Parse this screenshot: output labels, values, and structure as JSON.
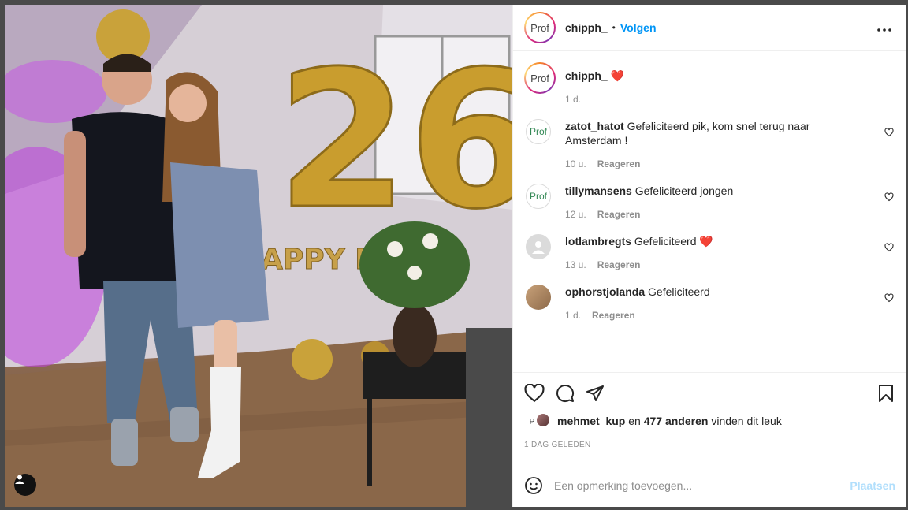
{
  "post": {
    "author": "chipph_",
    "follow_label": "Volgen",
    "separator": "•",
    "more_label": "•••",
    "avatar_text": "Prof"
  },
  "caption": {
    "username": "chipph_",
    "text": "❤️",
    "time": "1 d."
  },
  "comments": [
    {
      "username": "zatot_hatot",
      "text": "Gefeliciteerd pik, kom snel terug naar Amsterdam !",
      "time": "10 u.",
      "reply": "Reageren",
      "avatar": "Prof"
    },
    {
      "username": "tillymansens",
      "text": "Gefeliciteerd jongen",
      "time": "12 u.",
      "reply": "Reageren",
      "avatar": "Prof"
    },
    {
      "username": "lotlambregts",
      "text": "Gefeliciteerd ❤️",
      "time": "13 u.",
      "reply": "Reageren",
      "avatar": ""
    },
    {
      "username": "ophorstjolanda",
      "text": "Gefeliciteerd",
      "time": "1 d.",
      "reply": "Reageren",
      "avatar": ""
    }
  ],
  "likes": {
    "first_user": "mehmet_kup",
    "connector": "en",
    "count_text": "477 anderen",
    "suffix": "vinden dit leuk",
    "avatar_letter": "P"
  },
  "timestamp": "1 DAG GELEDEN",
  "add_comment": {
    "placeholder": "Een opmerking toevoegen...",
    "post_label": "Plaatsen"
  },
  "photo": {
    "balloon_text": "26",
    "banner_text": "APPY BI"
  },
  "colors": {
    "accent": "#0095f6",
    "like_red": "#ed4956",
    "post_disabled": "#b2dffc"
  }
}
